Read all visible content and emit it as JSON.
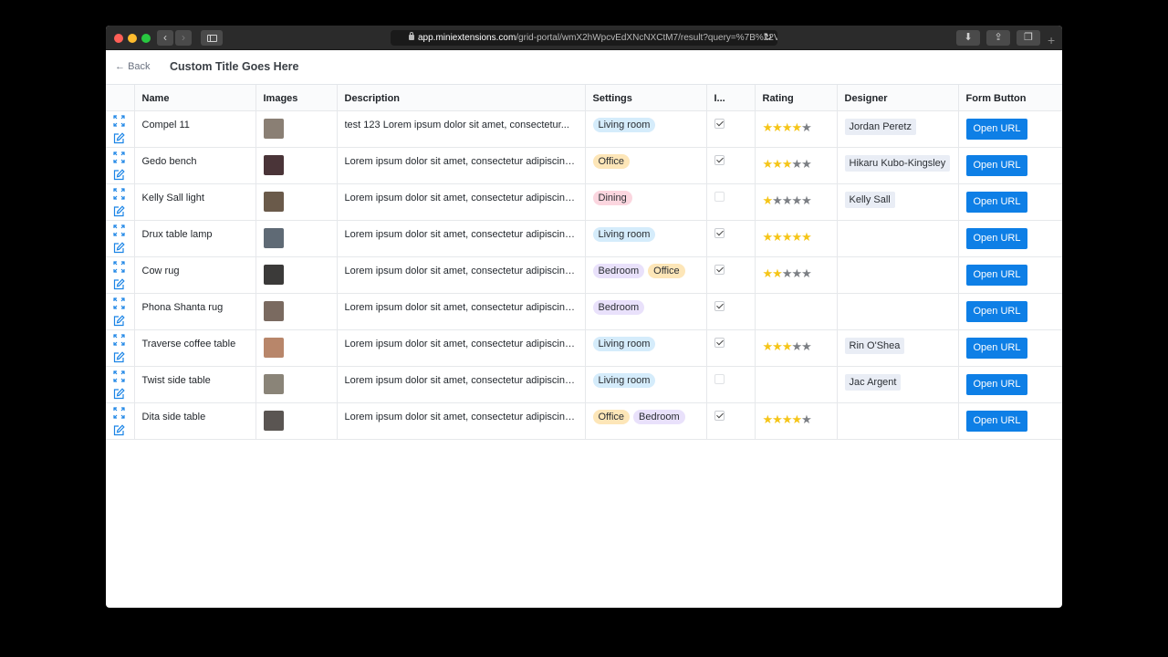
{
  "browser": {
    "url_host": "app.miniextensions.com",
    "url_path": "/grid-portal/wmX2hWpcvEdXNcNXCtM7/result?query=%7B%22V"
  },
  "header": {
    "back_label": "Back",
    "title": "Custom Title Goes Here"
  },
  "table": {
    "columns": [
      "Name",
      "Images",
      "Description",
      "Settings",
      "I...",
      "Rating",
      "Designer",
      "Form Button"
    ],
    "rows": [
      {
        "name": "Compel 11",
        "thumb_color": "#8a7f74",
        "description": "test 123 Lorem ipsum dolor sit amet, consectetur...",
        "tags": [
          {
            "label": "Living room",
            "kind": "living"
          }
        ],
        "checked": true,
        "rating": 4,
        "designer": "Jordan Peretz",
        "button": "Open URL"
      },
      {
        "name": "Gedo bench",
        "thumb_color": "#4a3438",
        "description": "Lorem ipsum dolor sit amet, consectetur adipiscing...",
        "tags": [
          {
            "label": "Office",
            "kind": "office"
          }
        ],
        "checked": true,
        "rating": 3,
        "designer": "Hikaru Kubo-Kingsley",
        "button": "Open URL"
      },
      {
        "name": "Kelly Sall light",
        "thumb_color": "#6a5a4a",
        "description": "Lorem ipsum dolor sit amet, consectetur adipiscing...",
        "tags": [
          {
            "label": "Dining",
            "kind": "dining"
          }
        ],
        "checked": false,
        "rating": 1,
        "designer": "Kelly Sall",
        "button": "Open URL"
      },
      {
        "name": "Drux table lamp",
        "thumb_color": "#5f6a75",
        "description": "Lorem ipsum dolor sit amet, consectetur adipiscing...",
        "tags": [
          {
            "label": "Living room",
            "kind": "living"
          }
        ],
        "checked": true,
        "rating": 5,
        "designer": "",
        "button": "Open URL"
      },
      {
        "name": "Cow rug",
        "thumb_color": "#3b3a39",
        "description": "Lorem ipsum dolor sit amet, consectetur adipiscing...",
        "tags": [
          {
            "label": "Bedroom",
            "kind": "bedroom"
          },
          {
            "label": "Office",
            "kind": "office"
          }
        ],
        "checked": true,
        "rating": 2,
        "designer": "",
        "button": "Open URL"
      },
      {
        "name": "Phona Shanta rug",
        "thumb_color": "#7a6a60",
        "description": "Lorem ipsum dolor sit amet, consectetur adipiscing...",
        "tags": [
          {
            "label": "Bedroom",
            "kind": "bedroom"
          }
        ],
        "checked": true,
        "rating": 0,
        "designer": "",
        "button": "Open URL"
      },
      {
        "name": "Traverse coffee table",
        "thumb_color": "#b8866a",
        "description": "Lorem ipsum dolor sit amet, consectetur adipiscing...",
        "tags": [
          {
            "label": "Living room",
            "kind": "living"
          }
        ],
        "checked": true,
        "rating": 3,
        "designer": "Rin O'Shea",
        "button": "Open URL"
      },
      {
        "name": "Twist side table",
        "thumb_color": "#8a8478",
        "description": "Lorem ipsum dolor sit amet, consectetur adipiscing...",
        "tags": [
          {
            "label": "Living room",
            "kind": "living"
          }
        ],
        "checked": false,
        "rating": 0,
        "designer": "Jac Argent",
        "button": "Open URL"
      },
      {
        "name": "Dita side table",
        "thumb_color": "#5a5552",
        "description": "Lorem ipsum dolor sit amet, consectetur adipiscing...",
        "tags": [
          {
            "label": "Office",
            "kind": "office"
          },
          {
            "label": "Bedroom",
            "kind": "bedroom"
          }
        ],
        "checked": true,
        "rating": 4,
        "designer": "",
        "button": "Open URL"
      }
    ]
  }
}
